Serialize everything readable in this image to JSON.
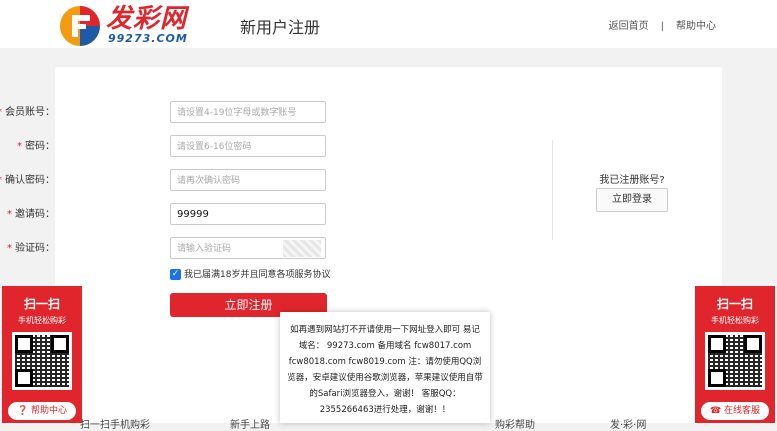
{
  "header": {
    "logo_text": "发彩网",
    "logo_sub": "99273.COM",
    "page_title": "新用户注册",
    "links": [
      "返回首页",
      "帮助中心"
    ],
    "separator": "|"
  },
  "form": {
    "fields": [
      {
        "label": "会员账号：",
        "placeholder": "请设置4-19位字母或数字账号",
        "value": ""
      },
      {
        "label": "密码：",
        "placeholder": "请设置6-16位密码",
        "value": ""
      },
      {
        "label": "确认密码：",
        "placeholder": "请再次确认密码",
        "value": ""
      },
      {
        "label": "邀请码：",
        "placeholder": "",
        "value": "99999"
      },
      {
        "label": "验证码：",
        "placeholder": "请输入验证码",
        "value": ""
      }
    ],
    "agree_text": "我已届满18岁并且同意各项服务协议",
    "submit_label": "立即注册"
  },
  "side": {
    "already_text": "我已注册账号?",
    "login_label": "立即登录"
  },
  "left_float": {
    "title": "扫一扫",
    "subtitle": "手机轻松购彩",
    "button": "帮助中心"
  },
  "right_float": {
    "title": "扫一扫",
    "subtitle": "手机轻松购彩",
    "button": "在线客服"
  },
  "notice": {
    "text": "如再遇到网站打不开请使用一下网址登入即可 易记域名： 99273.com 备用域名 fcw8017.com fcw8018.com fcw8019.com 注：请勿使用QQ浏览器，安卓建议使用谷歌浏览器，苹果建议使用自带的Safari浏览器登入，谢谢！ 客服QQ：2355266463进行处理，谢谢！！"
  },
  "bottom": [
    "扫一扫手机购彩",
    "新手上路",
    "购彩帮助",
    "发·彩·网"
  ],
  "colors": {
    "brand_red": "#e0262c",
    "brand_blue": "#1d5aa8"
  }
}
